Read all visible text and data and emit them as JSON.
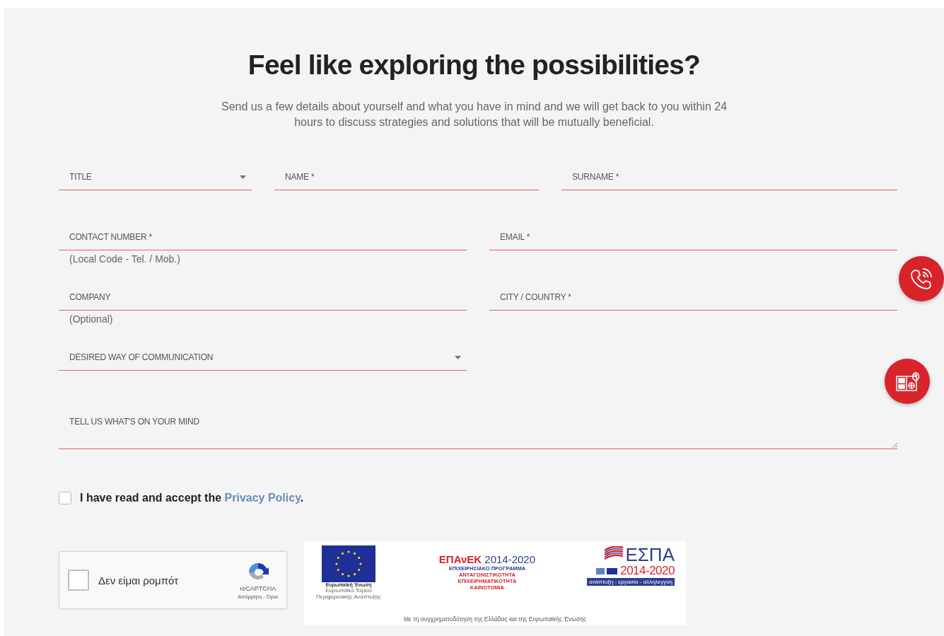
{
  "heading": "Feel like exploring the possibilities?",
  "intro": "Send us a few details about yourself and what you have in mind and we will get back to you within 24 hours to discuss strategies and solutions that will be mutually beneficial.",
  "form_rows": [
    {
      "fields": [
        {
          "kind": "select",
          "label": "TITLE"
        },
        {
          "kind": "text",
          "label": "NAME *"
        },
        {
          "kind": "text",
          "label": "SURNAME *"
        }
      ]
    },
    {
      "fields": [
        {
          "kind": "text",
          "label": "CONTACT NUMBER *",
          "hint": "(Local Code - Tel. / Mob.)"
        },
        {
          "kind": "text",
          "label": "EMAIL *"
        }
      ]
    },
    {
      "fields": [
        {
          "kind": "text",
          "label": "COMPANY",
          "hint": "(Optional)"
        },
        {
          "kind": "text",
          "label": "CITY / COUNTRY *"
        }
      ]
    },
    {
      "fields": [
        {
          "kind": "select",
          "label": "DESIRED WAY OF COMMUNICATION"
        }
      ]
    },
    {
      "fields": [
        {
          "kind": "textarea",
          "label": "TELL US WHAT'S ON YOUR MIND"
        }
      ]
    }
  ],
  "privacy": {
    "checked": false,
    "text": "I have read and accept the ",
    "link": "Privacy Policy",
    "end": "."
  },
  "captcha": {
    "checked": false,
    "label": "Δεν είμαι ρομπότ",
    "brand": "reCAPTCHA",
    "links": "Απόρρητο - Όροι"
  },
  "funding_banner": {
    "eu_title": "Ευρωπαϊκή Ένωση",
    "eu_subtitle": "Ευρωπαϊκό Ταμείο Περιφερειακής Ανάπτυξης",
    "epanek_name": "ΕΠΑνΕΚ",
    "epanek_years": "2014-2020",
    "epanek_lines": [
      "ΕΠΙΧΕΙΡΗΣΙΑΚΟ ΠΡΟΓΡΑΜΜΑ",
      "ΑΝΤΑΓΩΝΙΣΤΙΚΟΤΗΤΑ",
      "ΕΠΙΧΕΙΡΗΜΑΤΙΚΟΤΗΤΑ",
      "ΚΑΙΝΟΤΟΜΙΑ"
    ],
    "espa_name": "ΕΣΠΑ",
    "espa_years": "2014-2020",
    "espa_motto": "ανάπτυξη - εργασία - αλληλεγγύη",
    "footer": "Με τη συγχρηματοδότηση της Ελλάδας και της Ευρωπαϊκής Ένωσης"
  }
}
